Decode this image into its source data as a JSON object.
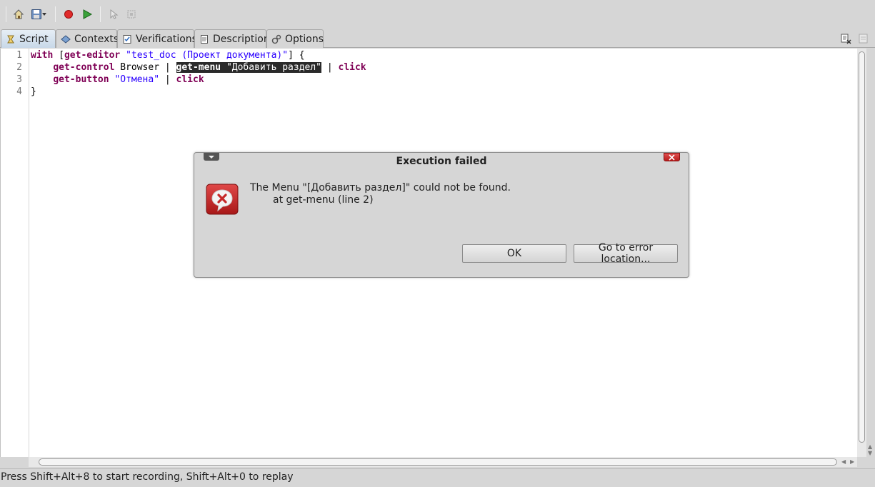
{
  "toolbar": {
    "icons": [
      "home-icon",
      "save-icon",
      "dropdown-arrow-icon",
      "record-icon",
      "replay-icon",
      "select-icon",
      "assert-icon"
    ]
  },
  "tabs": [
    {
      "label": "Script",
      "icon": "script-icon",
      "active": true
    },
    {
      "label": "Contexts",
      "icon": "contexts-icon",
      "active": false
    },
    {
      "label": "Verifications",
      "icon": "verifications-icon",
      "active": false
    },
    {
      "label": "Description",
      "icon": "description-icon",
      "active": false
    },
    {
      "label": "Options",
      "icon": "options-icon",
      "active": false
    }
  ],
  "editor": {
    "line_numbers": [
      "1",
      "2",
      "3",
      "4"
    ],
    "line1": {
      "kw_with": "with",
      "bracket_open": " [",
      "kw_get_editor": "get-editor",
      "str_doc": " \"test_doc (Проект документа)\"",
      "tail": "] {"
    },
    "line2": {
      "indent": "    ",
      "kw_get_control": "get-control",
      "plain_browser": " Browser | ",
      "sel_kw": "get-menu",
      "sel_str": " \"Добавить раздел\"",
      "pipe": " | ",
      "kw_click": "click"
    },
    "line3": {
      "indent": "    ",
      "kw_get_button": "get-button",
      "str_cancel": " \"Отмена\"",
      "pipe": " | ",
      "kw_click": "click"
    },
    "line4": {
      "close": "}"
    }
  },
  "dialog": {
    "title": "Execution failed",
    "message_line1": "The Menu \"[Добавить раздел]\" could not be found.",
    "message_line2": "at get-menu (line 2)",
    "ok_label": "OK",
    "goto_label": "Go to error location...",
    "icon": "error-icon"
  },
  "status_bar": {
    "text": "Press Shift+Alt+8 to start recording, Shift+Alt+0 to replay"
  },
  "colors": {
    "keyword": "#7f0055",
    "string": "#2a00ff",
    "selection": "#2a2a2a",
    "error_red": "#c62828"
  }
}
